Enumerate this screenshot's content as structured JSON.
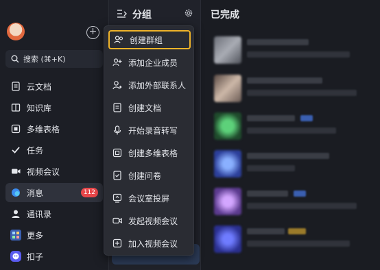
{
  "colors": {
    "accent": "#f0b429",
    "badge": "#e8474a",
    "background": "#1b1d23"
  },
  "sidebar": {
    "search_label": "搜索 (⌘+K)",
    "items": [
      {
        "label": "云文档",
        "icon": "document-icon"
      },
      {
        "label": "知识库",
        "icon": "book-icon"
      },
      {
        "label": "多维表格",
        "icon": "table-icon"
      },
      {
        "label": "任务",
        "icon": "check-icon"
      },
      {
        "label": "视频会议",
        "icon": "video-icon"
      },
      {
        "label": "消息",
        "icon": "message-icon",
        "badge": "112",
        "active": true
      },
      {
        "label": "通讯录",
        "icon": "contacts-icon"
      },
      {
        "label": "更多",
        "icon": "grid-icon"
      },
      {
        "label": "扣子",
        "icon": "bot-icon"
      }
    ]
  },
  "middle": {
    "title": "分组"
  },
  "right": {
    "title": "已完成"
  },
  "menu": {
    "items": [
      {
        "label": "创建群组",
        "icon": "group-icon",
        "highlighted": true
      },
      {
        "label": "添加企业成员",
        "icon": "add-member-icon"
      },
      {
        "label": "添加外部联系人",
        "icon": "add-contact-icon"
      },
      {
        "label": "创建文档",
        "icon": "doc-icon"
      },
      {
        "label": "开始录音转写",
        "icon": "mic-icon"
      },
      {
        "label": "创建多维表格",
        "icon": "table-icon"
      },
      {
        "label": "创建问卷",
        "icon": "survey-icon"
      },
      {
        "label": "会议室投屏",
        "icon": "screen-share-icon"
      },
      {
        "label": "发起视频会议",
        "icon": "video-icon"
      },
      {
        "label": "加入视频会议",
        "icon": "join-icon"
      }
    ]
  }
}
